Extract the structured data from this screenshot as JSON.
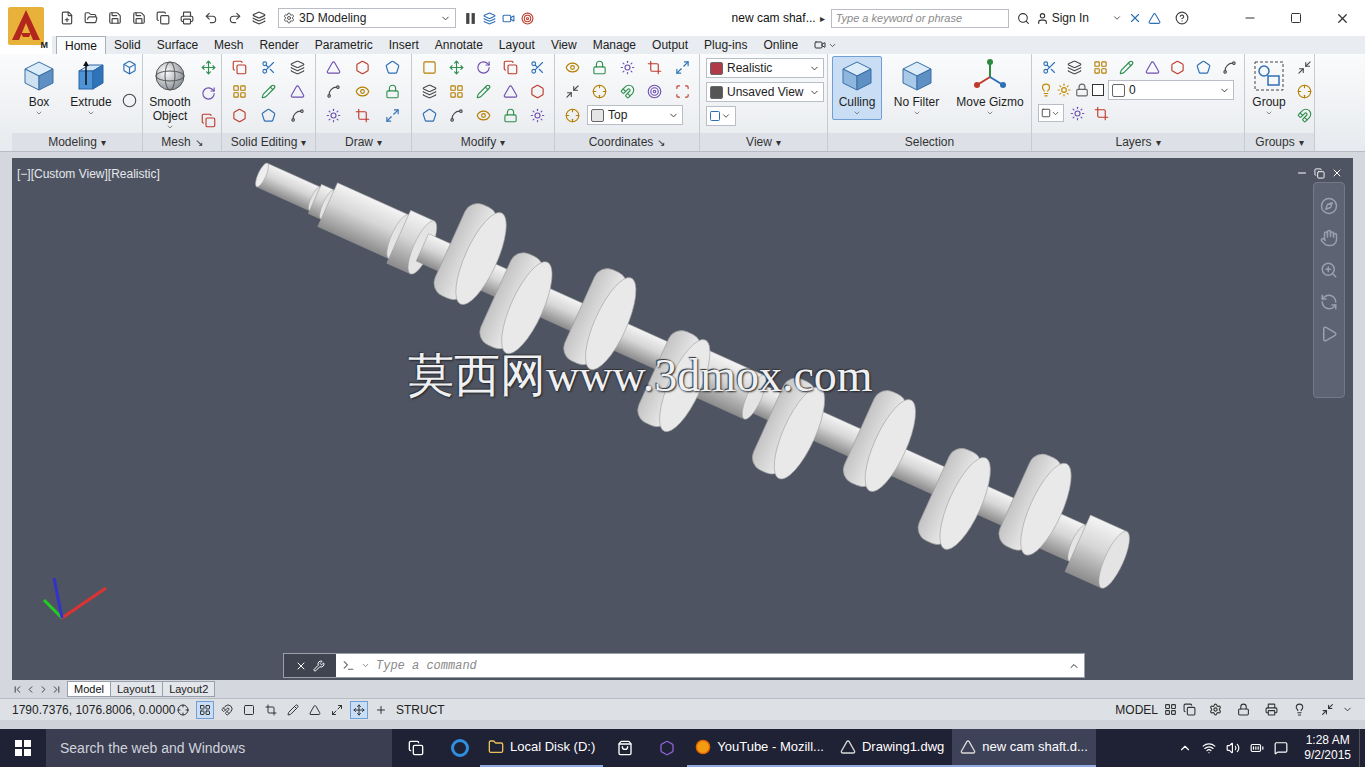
{
  "app": {
    "logo_badge": "M",
    "workspace": "3D Modeling"
  },
  "window": {
    "title": "new cam shaf...",
    "title_arrow": "▸"
  },
  "search": {
    "placeholder": "Type a keyword or phrase"
  },
  "account": {
    "label": "Sign In"
  },
  "tabs": [
    {
      "label": "Home",
      "selected": true
    },
    {
      "label": "Solid",
      "selected": false
    },
    {
      "label": "Surface",
      "selected": false
    },
    {
      "label": "Mesh",
      "selected": false
    },
    {
      "label": "Render",
      "selected": false
    },
    {
      "label": "Parametric",
      "selected": false
    },
    {
      "label": "Insert",
      "selected": false
    },
    {
      "label": "Annotate",
      "selected": false
    },
    {
      "label": "Layout",
      "selected": false
    },
    {
      "label": "View",
      "selected": false
    },
    {
      "label": "Manage",
      "selected": false
    },
    {
      "label": "Output",
      "selected": false
    },
    {
      "label": "Plug-ins",
      "selected": false
    },
    {
      "label": "Online",
      "selected": false
    }
  ],
  "ribbon": {
    "groups": [
      {
        "label": "Modeling",
        "launcher": "▾",
        "kind": "modeling",
        "buttons": [
          {
            "label": "Box",
            "selected": false
          },
          {
            "label": "Extrude",
            "selected": false
          }
        ]
      },
      {
        "label": "Mesh",
        "launcher": "↘",
        "kind": "mesh",
        "buttons": [
          {
            "label": "Smooth Object",
            "selected": false
          }
        ]
      },
      {
        "label": "Solid Editing",
        "launcher": "▾",
        "kind": "solid-editing"
      },
      {
        "label": "Draw",
        "launcher": "▾",
        "kind": "draw"
      },
      {
        "label": "Modify",
        "launcher": "▾",
        "kind": "modify"
      },
      {
        "label": "Coordinates",
        "launcher": "↘",
        "kind": "coordinates",
        "dropdowns": [
          {
            "value": "Top"
          }
        ]
      },
      {
        "label": "View",
        "launcher": "▾",
        "kind": "view",
        "dropdowns": [
          {
            "value": "Realistic"
          },
          {
            "value": "Unsaved View"
          }
        ]
      },
      {
        "label": "Selection",
        "kind": "selection",
        "buttons": [
          {
            "label": "Culling",
            "selected": true
          },
          {
            "label": "No Filter",
            "selected": false
          },
          {
            "label": "Move Gizmo",
            "selected": false
          }
        ]
      },
      {
        "label": "Layers",
        "launcher": "▾",
        "kind": "layers",
        "dropdowns": [
          {
            "value": "0"
          }
        ]
      },
      {
        "label": "Groups",
        "launcher": "▾",
        "kind": "groups",
        "buttons": [
          {
            "label": "Group",
            "selected": false
          }
        ]
      }
    ]
  },
  "viewport": {
    "label": "[−][Custom View][Realistic]",
    "watermark": "莫西网www.3dmox.com"
  },
  "command_line": {
    "placeholder": "Type a command"
  },
  "layout_tabs": [
    {
      "label": "Model",
      "selected": true
    },
    {
      "label": "Layout1",
      "selected": false
    },
    {
      "label": "Layout2",
      "selected": false
    }
  ],
  "status_bar": {
    "coordinates": "1790.7376, 1076.8006, 0.0000",
    "snap_label": "STRUCT",
    "space": "MODEL"
  },
  "taskbar": {
    "search_placeholder": "Search the web and Windows",
    "apps": [
      {
        "label": "Local Disk (D:)",
        "active": false
      },
      {
        "label": "YouTube - Mozill...",
        "active": false
      },
      {
        "label": "Drawing1.dwg",
        "active": false
      },
      {
        "label": "new cam shaft.d...",
        "active": true
      }
    ],
    "time": "1:28 AM",
    "date": "9/2/2015"
  }
}
